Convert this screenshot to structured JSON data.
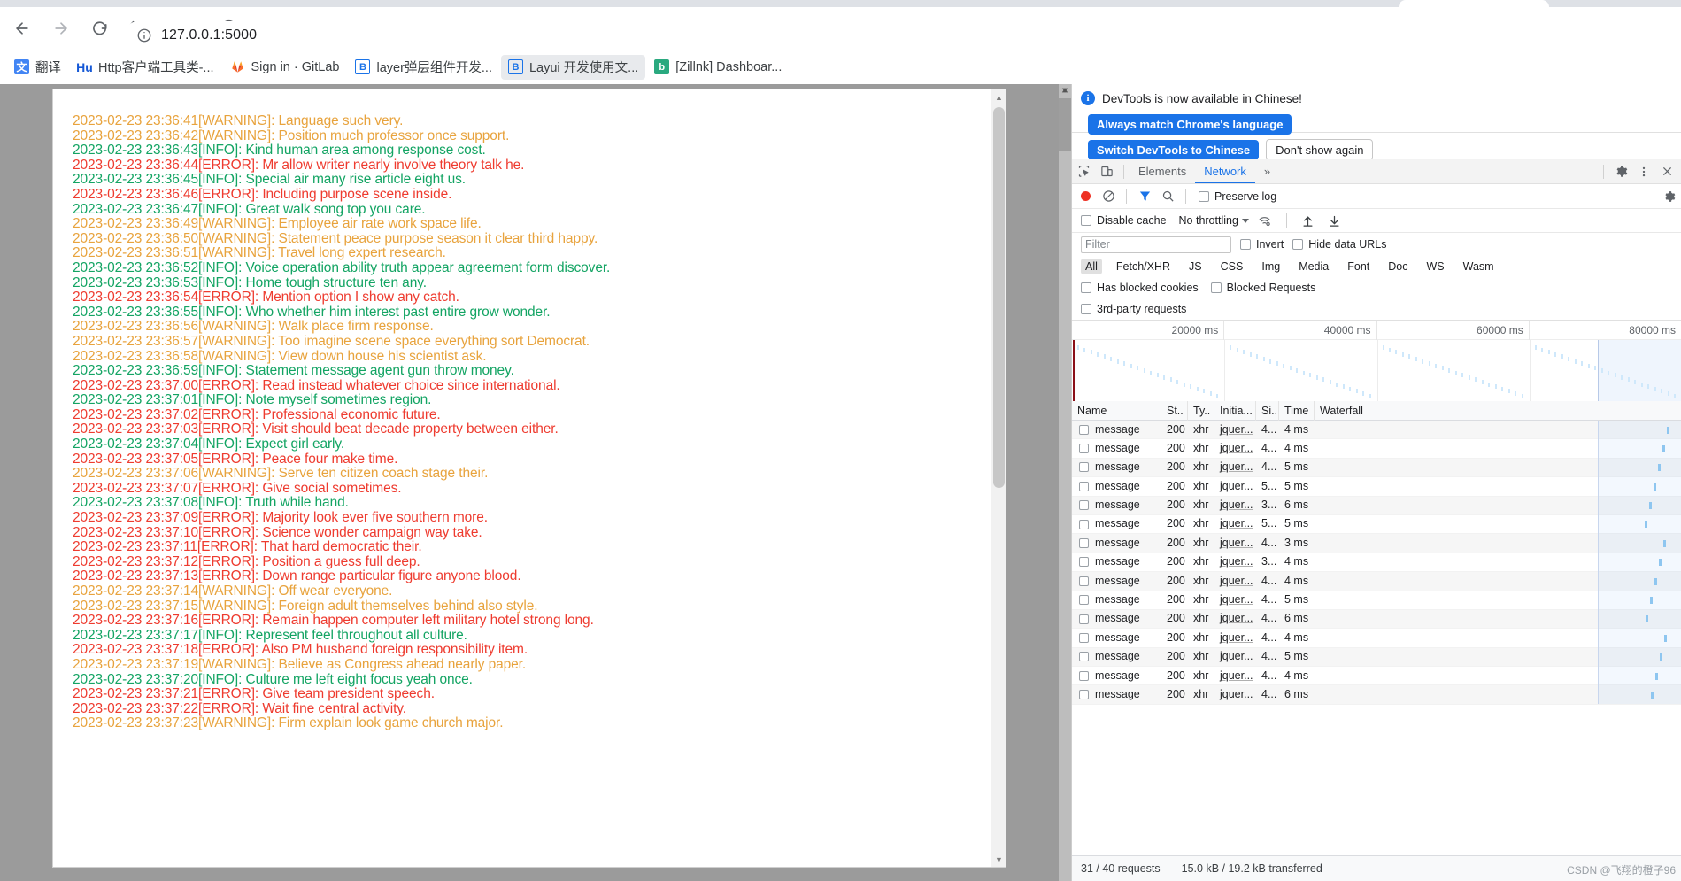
{
  "browser": {
    "url": "127.0.0.1:5000",
    "nav": {
      "back": "back-arrow",
      "forward": "forward-arrow",
      "reload": "reload"
    },
    "bookmarks": [
      {
        "label": "翻译",
        "icon_text": "译",
        "icon_bg": "#4285f4",
        "icon_color": "#ffffff"
      },
      {
        "label": "Http客户端工具类-...",
        "icon_text": "Hu",
        "icon_bg": "#ffffff",
        "icon_color": "#1a73e8"
      },
      {
        "label": "Sign in · GitLab",
        "icon_text": "",
        "icon_bg": "#ffffff",
        "icon_color": "#e24329"
      },
      {
        "label": "layer弹层组件开发...",
        "icon_text": "B",
        "icon_bg": "#ffffff",
        "icon_color": "#1a73e8"
      },
      {
        "label": "Layui 开发使用文...",
        "icon_text": "B",
        "icon_bg": "#ffffff",
        "icon_color": "#1a73e8"
      },
      {
        "label": "[Zillnk] Dashboar...",
        "icon_text": "b",
        "icon_bg": "#2aa97f",
        "icon_color": "#ffffff"
      }
    ]
  },
  "log": {
    "lines": [
      {
        "time": "2023-02-23 23:36:41",
        "level": "WARNING",
        "message": "Language such very."
      },
      {
        "time": "2023-02-23 23:36:42",
        "level": "WARNING",
        "message": "Position much professor once support."
      },
      {
        "time": "2023-02-23 23:36:43",
        "level": "INFO",
        "message": "Kind human area among response cost."
      },
      {
        "time": "2023-02-23 23:36:44",
        "level": "ERROR",
        "message": "Mr allow writer nearly involve theory talk he."
      },
      {
        "time": "2023-02-23 23:36:45",
        "level": "INFO",
        "message": "Special air many rise article eight us."
      },
      {
        "time": "2023-02-23 23:36:46",
        "level": "ERROR",
        "message": "Including purpose scene inside."
      },
      {
        "time": "2023-02-23 23:36:47",
        "level": "INFO",
        "message": "Great walk song top you care."
      },
      {
        "time": "2023-02-23 23:36:49",
        "level": "WARNING",
        "message": "Employee air rate work space life."
      },
      {
        "time": "2023-02-23 23:36:50",
        "level": "WARNING",
        "message": "Statement peace purpose season it clear third happy."
      },
      {
        "time": "2023-02-23 23:36:51",
        "level": "WARNING",
        "message": "Travel long expert research."
      },
      {
        "time": "2023-02-23 23:36:52",
        "level": "INFO",
        "message": "Voice operation ability truth appear agreement form discover."
      },
      {
        "time": "2023-02-23 23:36:53",
        "level": "INFO",
        "message": "Home tough structure ten any."
      },
      {
        "time": "2023-02-23 23:36:54",
        "level": "ERROR",
        "message": "Mention option I show any catch."
      },
      {
        "time": "2023-02-23 23:36:55",
        "level": "INFO",
        "message": "Who whether him interest past entire grow wonder."
      },
      {
        "time": "2023-02-23 23:36:56",
        "level": "WARNING",
        "message": "Walk place firm response."
      },
      {
        "time": "2023-02-23 23:36:57",
        "level": "WARNING",
        "message": "Too imagine scene space everything sort Democrat."
      },
      {
        "time": "2023-02-23 23:36:58",
        "level": "WARNING",
        "message": "View down house his scientist ask."
      },
      {
        "time": "2023-02-23 23:36:59",
        "level": "INFO",
        "message": "Statement message agent gun throw money."
      },
      {
        "time": "2023-02-23 23:37:00",
        "level": "ERROR",
        "message": "Read instead whatever choice since international."
      },
      {
        "time": "2023-02-23 23:37:01",
        "level": "INFO",
        "message": "Note myself sometimes region."
      },
      {
        "time": "2023-02-23 23:37:02",
        "level": "ERROR",
        "message": "Professional economic future."
      },
      {
        "time": "2023-02-23 23:37:03",
        "level": "ERROR",
        "message": "Visit should beat decade property between either."
      },
      {
        "time": "2023-02-23 23:37:04",
        "level": "INFO",
        "message": "Expect girl early."
      },
      {
        "time": "2023-02-23 23:37:05",
        "level": "ERROR",
        "message": "Peace four make time."
      },
      {
        "time": "2023-02-23 23:37:06",
        "level": "WARNING",
        "message": "Serve ten citizen coach stage their."
      },
      {
        "time": "2023-02-23 23:37:07",
        "level": "ERROR",
        "message": "Give social sometimes."
      },
      {
        "time": "2023-02-23 23:37:08",
        "level": "INFO",
        "message": "Truth while hand."
      },
      {
        "time": "2023-02-23 23:37:09",
        "level": "ERROR",
        "message": "Majority look ever five southern more."
      },
      {
        "time": "2023-02-23 23:37:10",
        "level": "ERROR",
        "message": "Science wonder campaign way take."
      },
      {
        "time": "2023-02-23 23:37:11",
        "level": "ERROR",
        "message": "That hard democratic their."
      },
      {
        "time": "2023-02-23 23:37:12",
        "level": "ERROR",
        "message": "Position a guess full deep."
      },
      {
        "time": "2023-02-23 23:37:13",
        "level": "ERROR",
        "message": "Down range particular figure anyone blood."
      },
      {
        "time": "2023-02-23 23:37:14",
        "level": "WARNING",
        "message": "Off wear everyone."
      },
      {
        "time": "2023-02-23 23:37:15",
        "level": "WARNING",
        "message": "Foreign adult themselves behind also style."
      },
      {
        "time": "2023-02-23 23:37:16",
        "level": "ERROR",
        "message": "Remain happen computer left military hotel strong long."
      },
      {
        "time": "2023-02-23 23:37:17",
        "level": "INFO",
        "message": "Represent feel throughout all culture."
      },
      {
        "time": "2023-02-23 23:37:18",
        "level": "ERROR",
        "message": "Also PM husband foreign responsibility item."
      },
      {
        "time": "2023-02-23 23:37:19",
        "level": "WARNING",
        "message": "Believe as Congress ahead nearly paper."
      },
      {
        "time": "2023-02-23 23:37:20",
        "level": "INFO",
        "message": "Culture me left eight focus yeah once."
      },
      {
        "time": "2023-02-23 23:37:21",
        "level": "ERROR",
        "message": "Give team president speech."
      },
      {
        "time": "2023-02-23 23:37:22",
        "level": "ERROR",
        "message": "Wait fine central activity."
      },
      {
        "time": "2023-02-23 23:37:23",
        "level": "WARNING",
        "message": "Firm explain look game church major."
      }
    ]
  },
  "devtools": {
    "banner": {
      "text": "DevTools is now available in Chinese!",
      "primary_button": "Always match Chrome's language",
      "secondary_button": "Switch DevTools to Chinese",
      "dismiss_button": "Don't show again"
    },
    "tabs": [
      {
        "label": "Elements",
        "active": false
      },
      {
        "label": "Network",
        "active": true
      }
    ],
    "tabs_overflow": "»",
    "toolbar": {
      "preserve_log": "Preserve log",
      "disable_cache": "Disable cache",
      "throttling": "No throttling"
    },
    "filter": {
      "placeholder": "Filter",
      "value": "",
      "invert": "Invert",
      "hide_data_urls": "Hide data URLs"
    },
    "resource_types": [
      "All",
      "Fetch/XHR",
      "JS",
      "CSS",
      "Img",
      "Media",
      "Font",
      "Doc",
      "WS",
      "Wasm"
    ],
    "active_resource_type": "All",
    "more_filters": [
      "Has blocked cookies",
      "Blocked Requests",
      "3rd-party requests"
    ],
    "timeline_ticks": [
      "20000 ms",
      "40000 ms",
      "60000 ms",
      "80000 ms"
    ],
    "table": {
      "columns": [
        "Name",
        "St..",
        "Ty..",
        "Initia...",
        "Si..",
        "Time",
        "Waterfall"
      ],
      "rows": [
        {
          "name": "message",
          "status": "200",
          "type": "xhr",
          "initiator": "jquer...",
          "size": "4...",
          "time": "4 ms"
        },
        {
          "name": "message",
          "status": "200",
          "type": "xhr",
          "initiator": "jquer...",
          "size": "4...",
          "time": "4 ms"
        },
        {
          "name": "message",
          "status": "200",
          "type": "xhr",
          "initiator": "jquer...",
          "size": "4...",
          "time": "5 ms"
        },
        {
          "name": "message",
          "status": "200",
          "type": "xhr",
          "initiator": "jquer...",
          "size": "5...",
          "time": "5 ms"
        },
        {
          "name": "message",
          "status": "200",
          "type": "xhr",
          "initiator": "jquer...",
          "size": "3...",
          "time": "6 ms"
        },
        {
          "name": "message",
          "status": "200",
          "type": "xhr",
          "initiator": "jquer...",
          "size": "5...",
          "time": "5 ms"
        },
        {
          "name": "message",
          "status": "200",
          "type": "xhr",
          "initiator": "jquer...",
          "size": "4...",
          "time": "3 ms"
        },
        {
          "name": "message",
          "status": "200",
          "type": "xhr",
          "initiator": "jquer...",
          "size": "3...",
          "time": "4 ms"
        },
        {
          "name": "message",
          "status": "200",
          "type": "xhr",
          "initiator": "jquer...",
          "size": "4...",
          "time": "4 ms"
        },
        {
          "name": "message",
          "status": "200",
          "type": "xhr",
          "initiator": "jquer...",
          "size": "4...",
          "time": "5 ms"
        },
        {
          "name": "message",
          "status": "200",
          "type": "xhr",
          "initiator": "jquer...",
          "size": "4...",
          "time": "6 ms"
        },
        {
          "name": "message",
          "status": "200",
          "type": "xhr",
          "initiator": "jquer...",
          "size": "4...",
          "time": "4 ms"
        },
        {
          "name": "message",
          "status": "200",
          "type": "xhr",
          "initiator": "jquer...",
          "size": "4...",
          "time": "5 ms"
        },
        {
          "name": "message",
          "status": "200",
          "type": "xhr",
          "initiator": "jquer...",
          "size": "4...",
          "time": "4 ms"
        },
        {
          "name": "message",
          "status": "200",
          "type": "xhr",
          "initiator": "jquer...",
          "size": "4...",
          "time": "6 ms"
        }
      ]
    },
    "status": {
      "requests": "31 / 40 requests",
      "transferred": "15.0 kB / 19.2 kB transferred"
    },
    "watermark": "CSDN @飞翔的橙子96"
  }
}
